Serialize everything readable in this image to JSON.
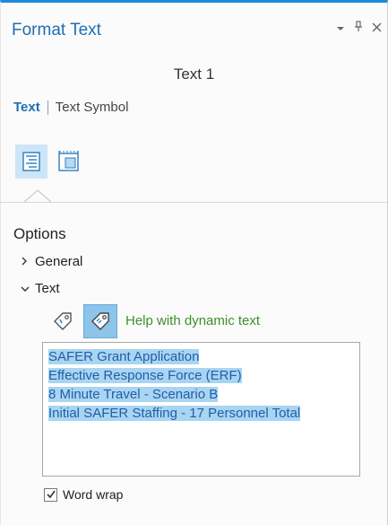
{
  "pane": {
    "title": "Format Text",
    "controls": {
      "menu_icon": "chevron-down-icon",
      "pin_icon": "pin-icon",
      "close_icon": "close-icon"
    }
  },
  "element_name": "Text 1",
  "tabs": [
    {
      "label": "Text",
      "active": true
    },
    {
      "label": "Text Symbol",
      "active": false
    }
  ],
  "icon_tabs": [
    {
      "name": "options-list-icon",
      "active": true
    },
    {
      "name": "position-icon",
      "active": false
    }
  ],
  "options": {
    "title": "Options",
    "groups": [
      {
        "label": "General",
        "expanded": false
      },
      {
        "label": "Text",
        "expanded": true
      }
    ]
  },
  "text_tools": {
    "insert_dynamic_icon": "tag-icon",
    "dynamic_text_icon": "dynamic-tag-icon",
    "help_link": "Help with dynamic text"
  },
  "text_content": [
    "SAFER Grant Application",
    "Effective Response Force (ERF)",
    "8 Minute Travel - Scenario B",
    "Initial SAFER Staffing - 17 Personnel Total"
  ],
  "word_wrap": {
    "label": "Word wrap",
    "checked": true
  },
  "colors": {
    "accent": "#1f6fb3",
    "link_green": "#3d8f2c",
    "selection": "#a9d4f2"
  }
}
